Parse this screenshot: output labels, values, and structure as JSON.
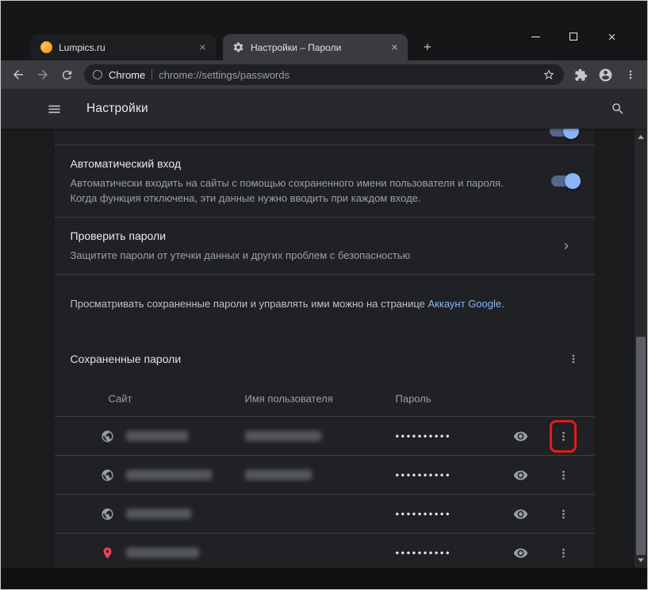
{
  "window": {
    "tabs": [
      {
        "label": "Lumpics.ru"
      },
      {
        "label": "Настройки – Пароли"
      }
    ]
  },
  "toolbar": {
    "site_label": "Chrome",
    "url": "chrome://settings/passwords"
  },
  "settings": {
    "title": "Настройки"
  },
  "page": {
    "auto_signin": {
      "title": "Автоматический вход",
      "description": "Автоматически входить на сайты с помощью сохраненного имени пользователя и пароля. Когда функция отключена, эти данные нужно вводить при каждом входе."
    },
    "check_passwords": {
      "title": "Проверить пароли",
      "description": "Защитите пароли от утечки данных и других проблем с безопасностью"
    },
    "account_note": {
      "prefix": "Просматривать сохраненные пароли и управлять ими можно на странице ",
      "link_text": "Аккаунт Google",
      "suffix": "."
    },
    "saved_passwords": {
      "title": "Сохраненные пароли",
      "columns": {
        "site": "Сайт",
        "username": "Имя пользователя",
        "password": "Пароль"
      },
      "rows": [
        {
          "password_mask": "••••••••••",
          "site_redacted": true,
          "username_redacted": true,
          "icon": "globe-icon",
          "annotated": true
        },
        {
          "password_mask": "••••••••••",
          "site_redacted": true,
          "username_redacted": true,
          "icon": "globe-icon",
          "annotated": false
        },
        {
          "password_mask": "••••••••••",
          "site_redacted": true,
          "username_redacted": false,
          "icon": "globe-icon",
          "annotated": false
        },
        {
          "password_mask": "••••••••••",
          "site_redacted": true,
          "username_redacted": false,
          "icon": "pin-icon",
          "annotated": false
        }
      ]
    }
  },
  "colors": {
    "accent_blue": "#8ab4f8",
    "link_blue": "#8ab4f8",
    "annotation_red": "#e31b1b",
    "pin_red": "#ef3e5e"
  }
}
